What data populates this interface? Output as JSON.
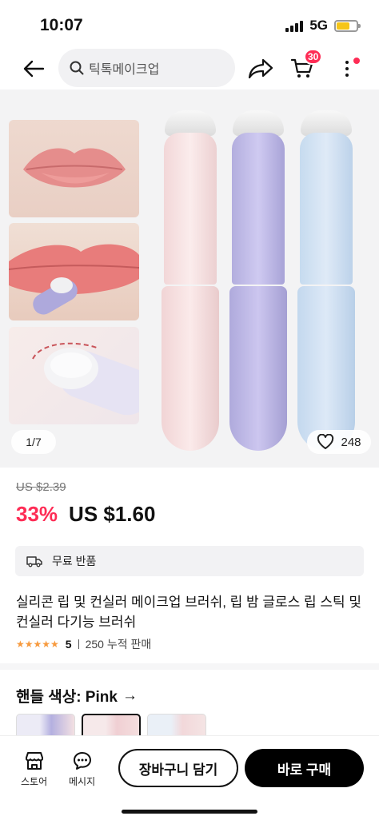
{
  "status": {
    "time": "10:07",
    "network": "5G"
  },
  "nav": {
    "search_text": "틱톡메이크업",
    "cart_count": "30"
  },
  "gallery": {
    "page_indicator": "1/7",
    "like_count": "248"
  },
  "price": {
    "original": "US $2.39",
    "discount": "33%",
    "sale": "US $1.60"
  },
  "returns": {
    "label": "무료 반품"
  },
  "product": {
    "title": "실리콘 립 및 컨실러 메이크업 브러쉬, 립 밤 글로스 립 스틱 및 컨실러 다기능 브러쉬",
    "stars": "★★★★★",
    "rating": "5",
    "sold": "250 누적 판매"
  },
  "variant": {
    "label": "핸들 색상: Pink",
    "arrow": "→"
  },
  "bottom": {
    "store_label": "스토어",
    "message_label": "메시지",
    "add_to_cart": "장바구니 담기",
    "buy_now": "바로 구매"
  },
  "colors": {
    "accent": "#fe2c55",
    "star": "#f79a3e",
    "primary_button": "#000000"
  }
}
